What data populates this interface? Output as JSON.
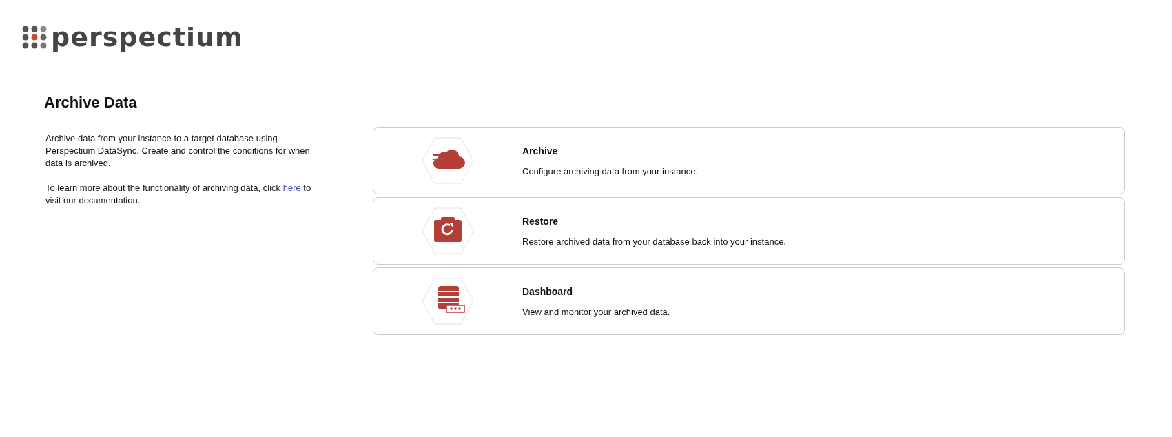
{
  "logo": {
    "text": "perspectium"
  },
  "page": {
    "title": "Archive Data"
  },
  "intro": {
    "paragraph": "Archive data from your instance to a target database using Perspectium DataSync. Create and control the conditions for when data is archived.",
    "learn_more": {
      "before": "To learn more about the functionality of archiving data, click",
      "link": "here",
      "after": "to visit our documentation."
    }
  },
  "cards": [
    {
      "kind": "archive",
      "title": "Archive",
      "description": "Configure archiving data from your instance."
    },
    {
      "kind": "restore",
      "title": "Restore",
      "description": "Restore archived data from your database back into your instance."
    },
    {
      "kind": "dashboard",
      "title": "Dashboard",
      "description": "View and monitor your archived data."
    }
  ]
}
